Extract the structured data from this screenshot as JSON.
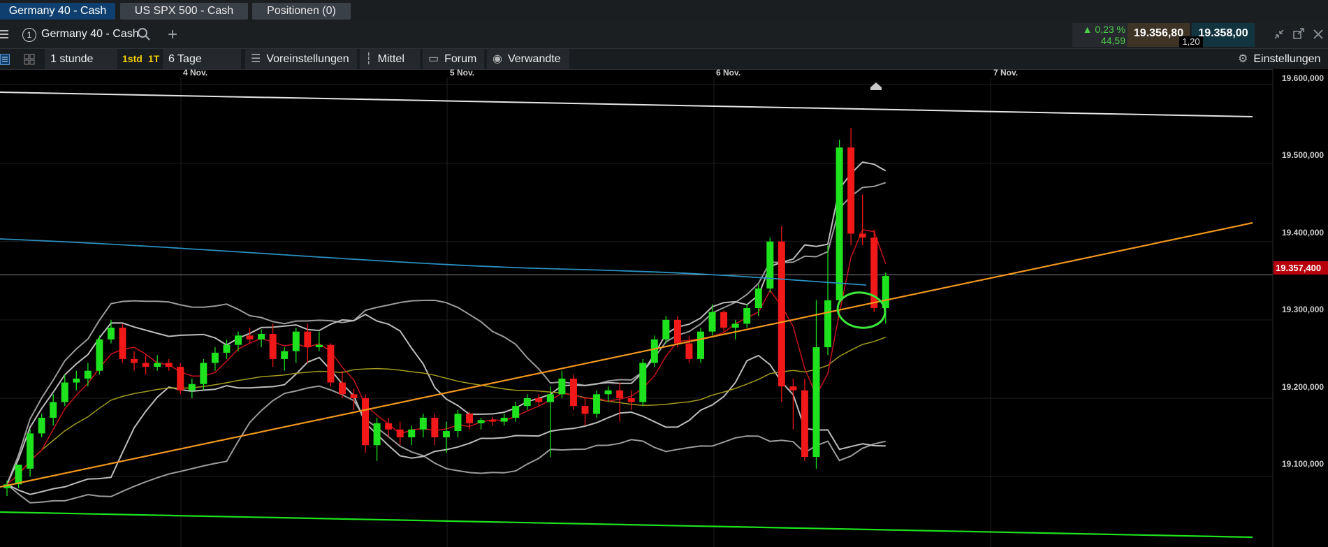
{
  "tabs": [
    {
      "label": "Germany 40 - Cash",
      "active": true
    },
    {
      "label": "US SPX 500 - Cash",
      "active": false
    },
    {
      "label": "Positionen (0)",
      "active": false
    }
  ],
  "toolbar": {
    "instrument_number": "1",
    "instrument_name": "Germany 40 - Cash",
    "change_pct": "0,23 %",
    "change_abs": "44,59",
    "bid": "19.356,80",
    "ask": "19.358,00",
    "spread": "1,20"
  },
  "options": {
    "interval": "1 stunde",
    "btn_1std": "1std",
    "btn_1t": "1T",
    "range": "6 Tage",
    "presets": "Voreinstellungen",
    "average": "Mittel",
    "forum": "Forum",
    "related": "Verwandte",
    "settings": "Einstellungen"
  },
  "chart_data": {
    "type": "candlestick",
    "instrument": "Germany 40 - Cash",
    "x_labels": [
      "4 Nov.",
      "5 Nov.",
      "6 Nov.",
      "7 Nov."
    ],
    "y_ticks": [
      "19.600,000",
      "19.500,000",
      "19.400,000",
      "19.300,000",
      "19.200,000",
      "19.100,000"
    ],
    "y_tick_values": [
      19600,
      19500,
      19400,
      19300,
      19200,
      19100
    ],
    "current_price_label": "19.357,400",
    "current_price": 19357.4,
    "ylim": [
      19010,
      19620
    ],
    "candles": [
      {
        "o": 19085,
        "h": 19095,
        "l": 19075,
        "c": 19090
      },
      {
        "o": 19090,
        "h": 19110,
        "l": 19085,
        "c": 19115
      },
      {
        "o": 19110,
        "h": 19160,
        "l": 19100,
        "c": 19155
      },
      {
        "o": 19155,
        "h": 19180,
        "l": 19150,
        "c": 19175
      },
      {
        "o": 19175,
        "h": 19205,
        "l": 19165,
        "c": 19195
      },
      {
        "o": 19195,
        "h": 19230,
        "l": 19190,
        "c": 19220
      },
      {
        "o": 19220,
        "h": 19235,
        "l": 19210,
        "c": 19225
      },
      {
        "o": 19225,
        "h": 19245,
        "l": 19215,
        "c": 19235
      },
      {
        "o": 19235,
        "h": 19280,
        "l": 19230,
        "c": 19275
      },
      {
        "o": 19275,
        "h": 19300,
        "l": 19270,
        "c": 19290
      },
      {
        "o": 19290,
        "h": 19295,
        "l": 19245,
        "c": 19250
      },
      {
        "o": 19250,
        "h": 19260,
        "l": 19235,
        "c": 19245
      },
      {
        "o": 19245,
        "h": 19255,
        "l": 19230,
        "c": 19240
      },
      {
        "o": 19240,
        "h": 19255,
        "l": 19235,
        "c": 19245
      },
      {
        "o": 19245,
        "h": 19250,
        "l": 19235,
        "c": 19240
      },
      {
        "o": 19240,
        "h": 19245,
        "l": 19205,
        "c": 19210
      },
      {
        "o": 19210,
        "h": 19225,
        "l": 19200,
        "c": 19218
      },
      {
        "o": 19218,
        "h": 19250,
        "l": 19210,
        "c": 19245
      },
      {
        "o": 19245,
        "h": 19265,
        "l": 19235,
        "c": 19258
      },
      {
        "o": 19258,
        "h": 19275,
        "l": 19250,
        "c": 19268
      },
      {
        "o": 19268,
        "h": 19285,
        "l": 19260,
        "c": 19280
      },
      {
        "o": 19280,
        "h": 19290,
        "l": 19270,
        "c": 19275
      },
      {
        "o": 19275,
        "h": 19288,
        "l": 19265,
        "c": 19282
      },
      {
        "o": 19282,
        "h": 19295,
        "l": 19240,
        "c": 19250
      },
      {
        "o": 19250,
        "h": 19265,
        "l": 19235,
        "c": 19260
      },
      {
        "o": 19260,
        "h": 19290,
        "l": 19245,
        "c": 19285
      },
      {
        "o": 19285,
        "h": 19295,
        "l": 19245,
        "c": 19265
      },
      {
        "o": 19265,
        "h": 19285,
        "l": 19260,
        "c": 19268
      },
      {
        "o": 19268,
        "h": 19270,
        "l": 19215,
        "c": 19220
      },
      {
        "o": 19220,
        "h": 19235,
        "l": 19200,
        "c": 19205
      },
      {
        "o": 19205,
        "h": 19212,
        "l": 19185,
        "c": 19200
      },
      {
        "o": 19200,
        "h": 19205,
        "l": 19130,
        "c": 19140
      },
      {
        "o": 19140,
        "h": 19175,
        "l": 19120,
        "c": 19168
      },
      {
        "o": 19168,
        "h": 19175,
        "l": 19150,
        "c": 19160
      },
      {
        "o": 19160,
        "h": 19170,
        "l": 19140,
        "c": 19150
      },
      {
        "o": 19150,
        "h": 19165,
        "l": 19140,
        "c": 19160
      },
      {
        "o": 19160,
        "h": 19180,
        "l": 19150,
        "c": 19175
      },
      {
        "o": 19175,
        "h": 19180,
        "l": 19140,
        "c": 19150
      },
      {
        "o": 19150,
        "h": 19170,
        "l": 19130,
        "c": 19158
      },
      {
        "o": 19158,
        "h": 19185,
        "l": 19150,
        "c": 19180
      },
      {
        "o": 19180,
        "h": 19182,
        "l": 19160,
        "c": 19168
      },
      {
        "o": 19168,
        "h": 19175,
        "l": 19160,
        "c": 19172
      },
      {
        "o": 19172,
        "h": 19176,
        "l": 19165,
        "c": 19170
      },
      {
        "o": 19170,
        "h": 19180,
        "l": 19165,
        "c": 19175
      },
      {
        "o": 19175,
        "h": 19195,
        "l": 19170,
        "c": 19190
      },
      {
        "o": 19190,
        "h": 19205,
        "l": 19185,
        "c": 19200
      },
      {
        "o": 19200,
        "h": 19205,
        "l": 19190,
        "c": 19195
      },
      {
        "o": 19195,
        "h": 19215,
        "l": 19125,
        "c": 19205
      },
      {
        "o": 19205,
        "h": 19235,
        "l": 19200,
        "c": 19225
      },
      {
        "o": 19225,
        "h": 19230,
        "l": 19185,
        "c": 19190
      },
      {
        "o": 19190,
        "h": 19200,
        "l": 19165,
        "c": 19180
      },
      {
        "o": 19180,
        "h": 19210,
        "l": 19175,
        "c": 19205
      },
      {
        "o": 19205,
        "h": 19215,
        "l": 19195,
        "c": 19210
      },
      {
        "o": 19210,
        "h": 19220,
        "l": 19170,
        "c": 19200
      },
      {
        "o": 19200,
        "h": 19210,
        "l": 19185,
        "c": 19195
      },
      {
        "o": 19195,
        "h": 19250,
        "l": 19190,
        "c": 19245
      },
      {
        "o": 19245,
        "h": 19280,
        "l": 19240,
        "c": 19275
      },
      {
        "o": 19275,
        "h": 19305,
        "l": 19270,
        "c": 19300
      },
      {
        "o": 19300,
        "h": 19305,
        "l": 19265,
        "c": 19270
      },
      {
        "o": 19270,
        "h": 19280,
        "l": 19245,
        "c": 19250
      },
      {
        "o": 19250,
        "h": 19290,
        "l": 19245,
        "c": 19285
      },
      {
        "o": 19285,
        "h": 19320,
        "l": 19280,
        "c": 19310
      },
      {
        "o": 19310,
        "h": 19312,
        "l": 19285,
        "c": 19290
      },
      {
        "o": 19290,
        "h": 19300,
        "l": 19275,
        "c": 19295
      },
      {
        "o": 19295,
        "h": 19320,
        "l": 19290,
        "c": 19315
      },
      {
        "o": 19315,
        "h": 19345,
        "l": 19305,
        "c": 19340
      },
      {
        "o": 19340,
        "h": 19405,
        "l": 19335,
        "c": 19400
      },
      {
        "o": 19400,
        "h": 19420,
        "l": 19195,
        "c": 19215
      },
      {
        "o": 19215,
        "h": 19225,
        "l": 19160,
        "c": 19210
      },
      {
        "o": 19210,
        "h": 19225,
        "l": 19120,
        "c": 19125
      },
      {
        "o": 19125,
        "h": 19325,
        "l": 19110,
        "c": 19265
      },
      {
        "o": 19265,
        "h": 19395,
        "l": 19255,
        "c": 19325
      },
      {
        "o": 19325,
        "h": 19530,
        "l": 19320,
        "c": 19520
      },
      {
        "o": 19520,
        "h": 19545,
        "l": 19395,
        "c": 19410
      },
      {
        "o": 19410,
        "h": 19460,
        "l": 19395,
        "c": 19405
      },
      {
        "o": 19405,
        "h": 19415,
        "l": 19310,
        "c": 19315
      },
      {
        "o": 19315,
        "h": 19360,
        "l": 19295,
        "c": 19356
      }
    ]
  }
}
